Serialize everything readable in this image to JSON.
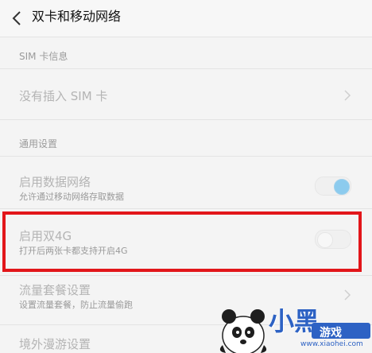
{
  "header": {
    "title": "双卡和移动网络"
  },
  "sim_section": {
    "label": "SIM 卡信息",
    "row_primary": "没有插入 SIM 卡"
  },
  "general_section": {
    "label": "通用设置",
    "items": [
      {
        "primary": "启用数据网络",
        "secondary": "允许通过移动网络存取数据",
        "toggle_state": "on"
      },
      {
        "primary": "启用双4G",
        "secondary": "打开后两张卡都支持开启4G",
        "toggle_state": "off"
      },
      {
        "primary": "流量套餐设置",
        "secondary": "设置流量套餐，防止流量偷跑"
      },
      {
        "primary": "境外漫游设置"
      }
    ]
  },
  "watermark": {
    "text": "小黑",
    "badge": "游戏",
    "url": "www.xiaohei.com",
    "brand_color": "#2d62c4"
  },
  "colors": {
    "highlight": "#e2161a",
    "toggle_on": "#8ccbee",
    "background": "#f4f4f4"
  },
  "icons": {
    "back": "chevron-left-icon",
    "row_nav": "chevron-right-icon"
  }
}
